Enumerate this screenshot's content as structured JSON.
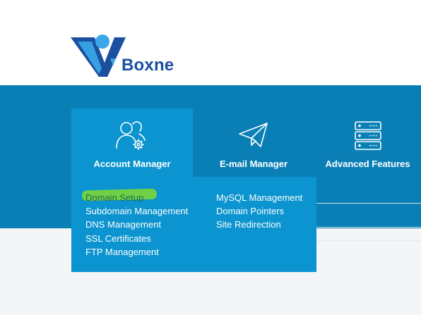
{
  "brand": {
    "name": "Boxne"
  },
  "nav": {
    "tabs": [
      {
        "label": "Account Manager",
        "icon": "users-gear-icon",
        "active": true
      },
      {
        "label": "E-mail Manager",
        "icon": "paper-plane-icon",
        "active": false
      },
      {
        "label": "Advanced Features",
        "icon": "server-stack-icon",
        "active": false
      }
    ]
  },
  "dropdown": {
    "left_column": [
      "Domain Setup",
      "Subdomain Management",
      "DNS Management",
      "SSL Certificates",
      "FTP Management"
    ],
    "right_column": [
      "MySQL Management",
      "Domain Pointers",
      "Site Redirection"
    ],
    "highlighted": "Domain Setup"
  },
  "colors": {
    "band": "#0a7fb6",
    "active_tab": "#0b94cf",
    "highlight": "#6fd046",
    "logo_blue": "#1b4fa0",
    "logo_light": "#3aa8e8"
  }
}
